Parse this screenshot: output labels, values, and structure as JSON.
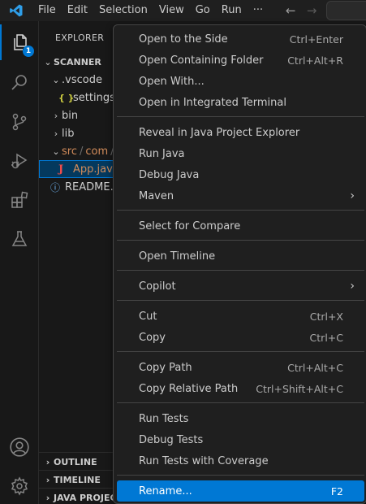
{
  "menubar": {
    "items": [
      "File",
      "Edit",
      "Selection",
      "View",
      "Go",
      "Run",
      "···"
    ],
    "back_arrow": "←",
    "forward_arrow": "→"
  },
  "activity": {
    "explorer_badge": "1"
  },
  "explorer": {
    "title": "EXPLORER",
    "root": "SCANNER",
    "tree": {
      "vscode": ".vscode",
      "settings_icon": "{ }",
      "settings": "settings.",
      "bin": "bin",
      "lib": "lib",
      "src": "src",
      "slash1": "/",
      "com": "com",
      "slash2": "/",
      "java_icon": "J",
      "app": "App.java",
      "info_icon": "ⓘ",
      "readme": "README."
    },
    "sections": {
      "outline": "OUTLINE",
      "timeline": "TIMELINE",
      "java_projects": "JAVA PROJECT"
    }
  },
  "context_menu": {
    "open_to_side": {
      "label": "Open to the Side",
      "shortcut": "Ctrl+Enter"
    },
    "open_containing_folder": {
      "label": "Open Containing Folder",
      "shortcut": "Ctrl+Alt+R"
    },
    "open_with": {
      "label": "Open With..."
    },
    "open_in_terminal": {
      "label": "Open in Integrated Terminal"
    },
    "reveal_java_explorer": {
      "label": "Reveal in Java Project Explorer"
    },
    "run_java": {
      "label": "Run Java"
    },
    "debug_java": {
      "label": "Debug Java"
    },
    "maven": {
      "label": "Maven"
    },
    "select_for_compare": {
      "label": "Select for Compare"
    },
    "open_timeline": {
      "label": "Open Timeline"
    },
    "copilot": {
      "label": "Copilot"
    },
    "cut": {
      "label": "Cut",
      "shortcut": "Ctrl+X"
    },
    "copy": {
      "label": "Copy",
      "shortcut": "Ctrl+C"
    },
    "copy_path": {
      "label": "Copy Path",
      "shortcut": "Ctrl+Alt+C"
    },
    "copy_relative_path": {
      "label": "Copy Relative Path",
      "shortcut": "Ctrl+Shift+Alt+C"
    },
    "run_tests": {
      "label": "Run Tests"
    },
    "debug_tests": {
      "label": "Debug Tests"
    },
    "run_tests_coverage": {
      "label": "Run Tests with Coverage"
    },
    "rename": {
      "label": "Rename...",
      "shortcut": "F2"
    },
    "submenu_glyph": "›"
  },
  "colors": {
    "accent": "#0078d4",
    "menu_bg": "#1f1f1f",
    "modified": "#d18b5a",
    "java_icon": "#f14c4c",
    "settings_icon": "#cbcb41",
    "info_icon": "#75beff"
  }
}
